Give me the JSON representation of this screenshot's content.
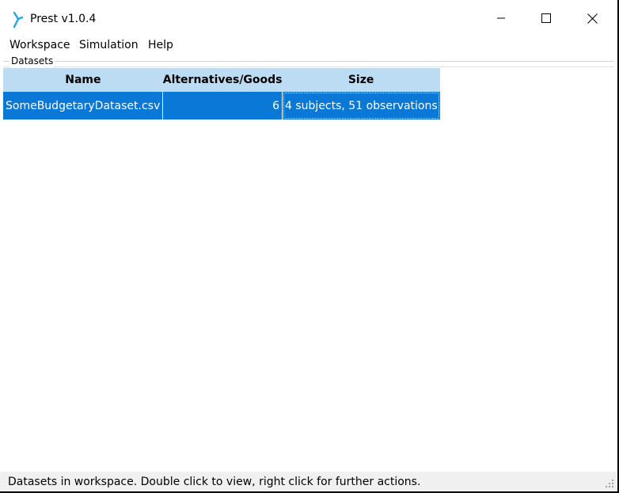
{
  "window": {
    "title": "Prest v1.0.4",
    "accent": "#0a78d7"
  },
  "menu": {
    "items": [
      "Workspace",
      "Simulation",
      "Help"
    ]
  },
  "datasets": {
    "group_label": "Datasets",
    "columns": [
      "Name",
      "Alternatives/Goods",
      "Size"
    ],
    "rows": [
      {
        "name": "SomeBudgetaryDataset.csv",
        "alternatives": "6",
        "size": "4 subjects, 51 observations"
      }
    ]
  },
  "status": {
    "text": "Datasets in workspace. Double click to view, right click for further actions."
  }
}
